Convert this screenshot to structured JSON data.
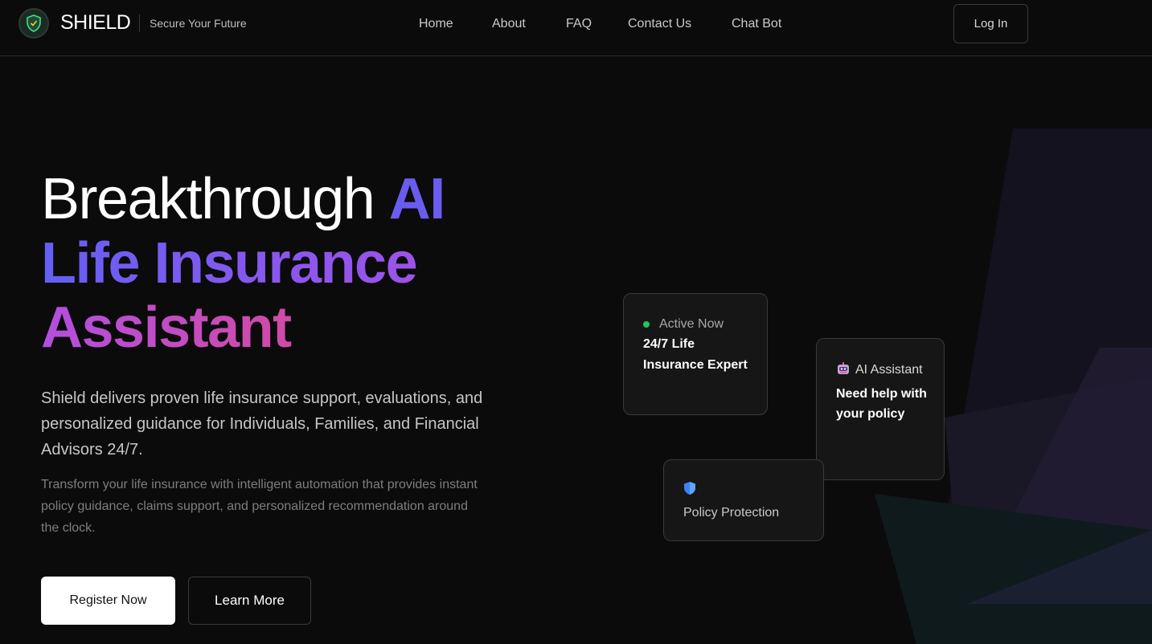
{
  "header": {
    "brand": "SHIELD",
    "tagline": "Secure Your Future",
    "nav": [
      "Home",
      "About",
      "FAQ",
      "Contact Us",
      "Chat Bot"
    ],
    "login_label": "Log In"
  },
  "hero": {
    "title_line1_white": "Breakthrough ",
    "title_line1_accent": "AI",
    "title_line2": "Life Insurance",
    "title_line3": "Assistant",
    "lead": "Shield delivers proven life insurance support, evaluations, and personalized guidance for Individuals, Families, and Financial Advisors 24/7.",
    "sub": "Transform your life insurance with intelligent automation that provides instant policy guidance, claims support, and personalized recommendation around the clock.",
    "primary_cta": "Register Now",
    "secondary_cta": "Learn More"
  },
  "cards": {
    "active": {
      "status": "Active Now",
      "title": "24/7 Life Insurance Expert"
    },
    "assistant": {
      "head": "AI Assistant",
      "title": "Need help with your policy"
    },
    "policy": {
      "label": "Policy Protection"
    }
  },
  "icons": {
    "logo": "shield-logo-icon",
    "status": "status-dot-icon",
    "assistant": "robot-icon",
    "policy": "shield-icon"
  },
  "colors": {
    "background": "#0b0b0b",
    "accent_indigo": "#6b5cf0",
    "accent_purple": "#a052e6",
    "accent_pink": "#e24b8e",
    "status_green": "#22c55e"
  }
}
